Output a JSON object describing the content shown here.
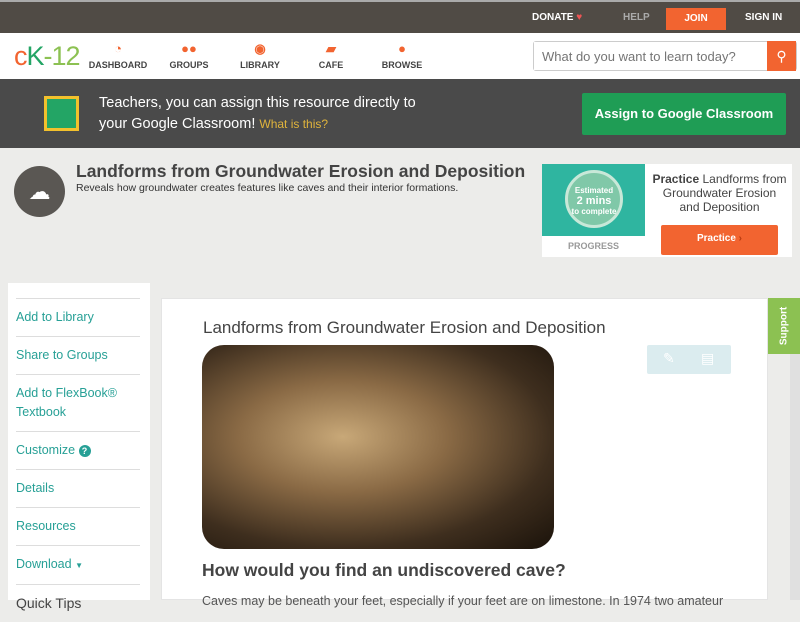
{
  "topbar": {
    "donate": "DONATE",
    "help": "HELP",
    "join": "JOIN",
    "signin": "SIGN IN"
  },
  "nav": {
    "logo": "cK-12",
    "items": [
      {
        "label": "DASHBOARD",
        "icon": "dashboard-icon"
      },
      {
        "label": "GROUPS",
        "icon": "groups-icon"
      },
      {
        "label": "LIBRARY",
        "icon": "library-icon"
      },
      {
        "label": "CAFE",
        "icon": "cafe-icon"
      },
      {
        "label": "BROWSE",
        "icon": "browse-icon"
      }
    ],
    "search_placeholder": "What do you want to learn today?"
  },
  "banner": {
    "line1": "Teachers, you can assign this resource directly to",
    "line2": "your Google Classroom!",
    "link": "What is this?",
    "button": "Assign to Google Classroom"
  },
  "header": {
    "title": "Landforms from Groundwater Erosion and Deposition",
    "subtitle": "Reveals how groundwater creates features like caves and their interior formations."
  },
  "practice": {
    "estimated": "Estimated",
    "mins": "2 mins",
    "complete": "to complete",
    "progress": "PROGRESS",
    "title_bold": "Practice",
    "title_rest": " Landforms from Groundwater Erosion and Deposition",
    "button": "Practice"
  },
  "sidebar": {
    "items": [
      "Add to Library",
      "Share to Groups",
      "Add to FlexBook® Textbook",
      "Customize",
      "Details",
      "Resources",
      "Download",
      "Quick Tips"
    ]
  },
  "content": {
    "title": "Landforms from Groundwater Erosion and Deposition",
    "question": "How would you find an undiscovered cave?",
    "body": "Caves may be beneath your feet, especially if your feet are on limestone. In 1974 two amateur"
  },
  "support": "Support"
}
